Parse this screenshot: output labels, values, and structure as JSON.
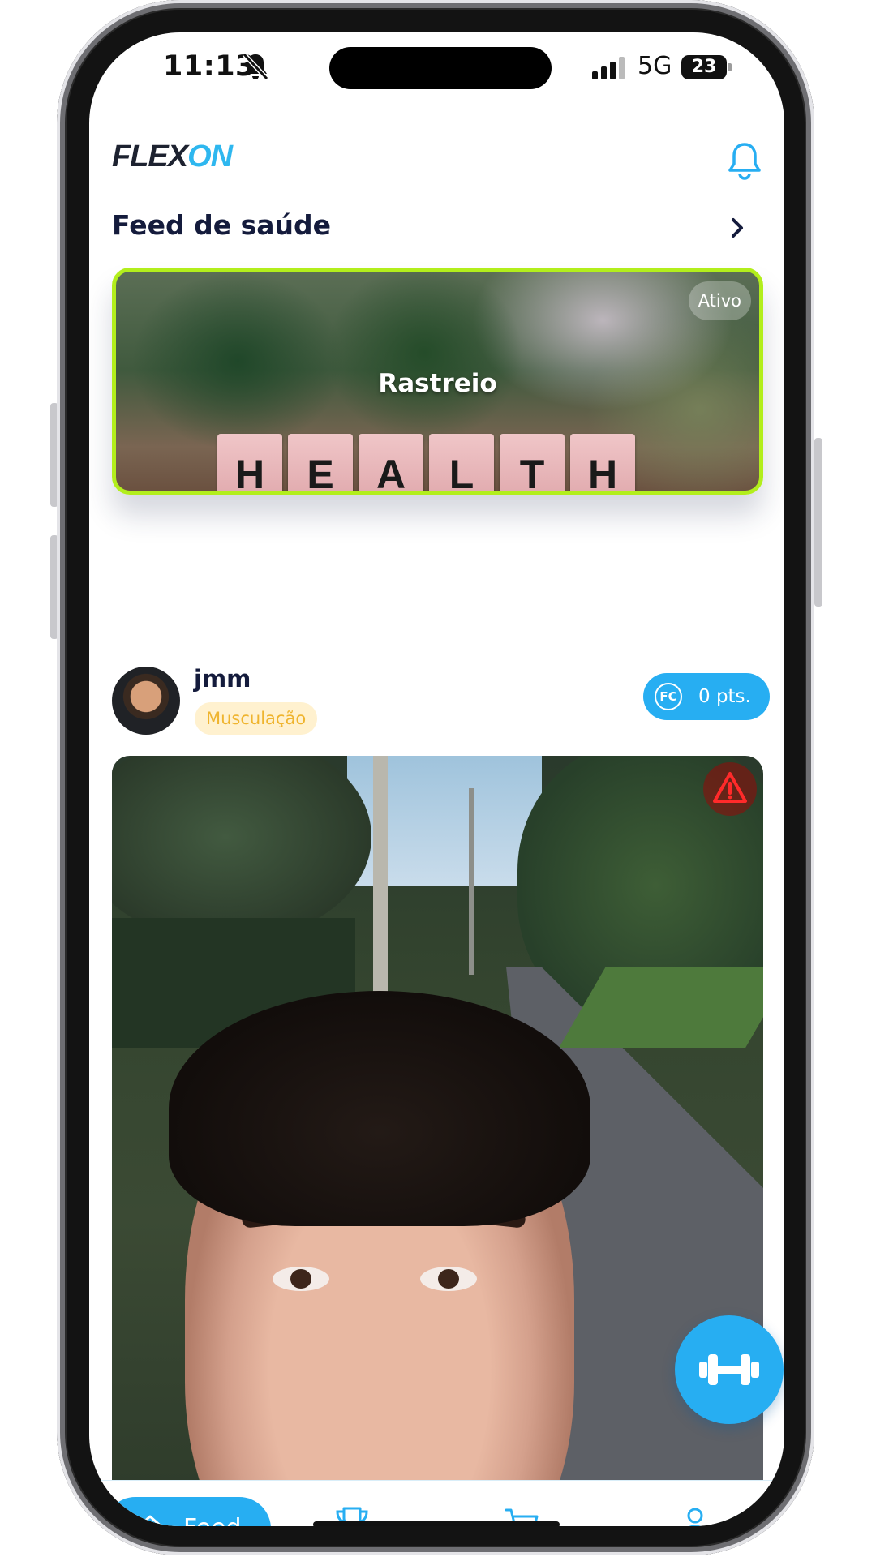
{
  "status_bar": {
    "time": "11:13",
    "network": "5G",
    "battery": "23"
  },
  "header": {
    "logo_prefix": "FLEX",
    "logo_suffix": "ON"
  },
  "feed": {
    "title": "Feed de saúde"
  },
  "banner": {
    "status": "Ativo",
    "title": "Rastreio",
    "tiles": [
      "H",
      "E",
      "A",
      "L",
      "T",
      "H"
    ]
  },
  "post": {
    "username": "jmm",
    "category": "Musculação",
    "points": "0 pts.",
    "points_icon": "FC"
  },
  "nav": {
    "feed_label": "Feed"
  },
  "colors": {
    "accent": "#27aef2",
    "banner_border": "#b2ee1c",
    "title": "#141b3c",
    "category_bg": "#fff1cf",
    "category_text": "#efb42e"
  },
  "icons": [
    "bell-off-icon",
    "signal-icon",
    "bell-icon",
    "chevron-right-icon",
    "warning-icon",
    "dumbbell-icon",
    "home-icon",
    "trophy-icon",
    "cart-icon",
    "user-icon"
  ]
}
